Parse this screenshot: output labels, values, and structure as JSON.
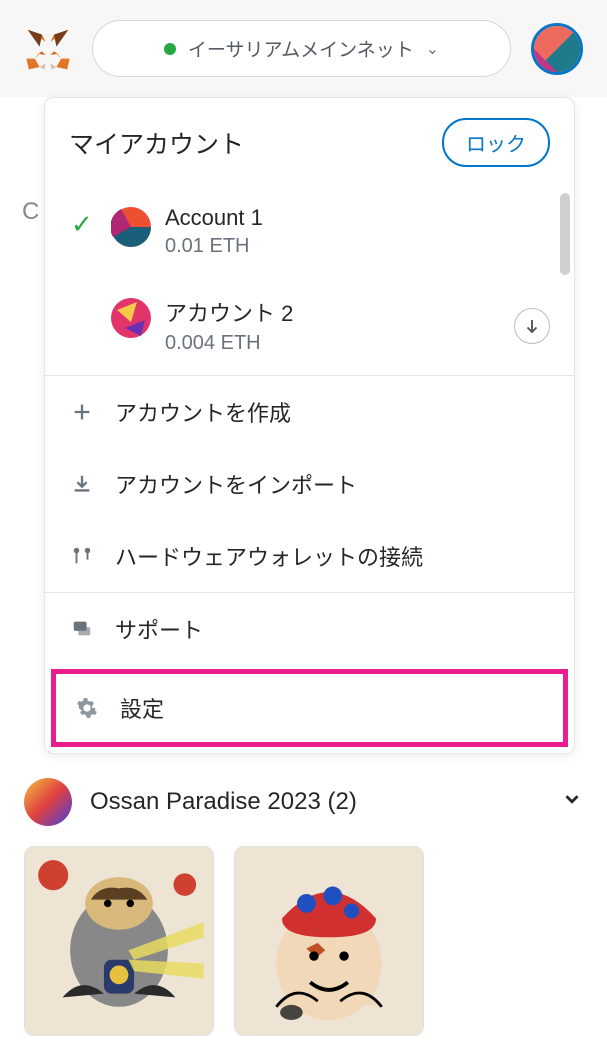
{
  "header": {
    "network_name": "イーサリアムメインネット"
  },
  "dropdown": {
    "title": "マイアカウント",
    "lock_label": "ロック"
  },
  "accounts": [
    {
      "name": "Account 1",
      "balance": "0.01 ETH",
      "selected": true
    },
    {
      "name": "アカウント 2",
      "balance": "0.004 ETH",
      "selected": false
    }
  ],
  "menu": {
    "create_account": "アカウントを作成",
    "import_account": "アカウントをインポート",
    "connect_hardware": "ハードウェアウォレットの接続",
    "support": "サポート",
    "settings": "設定"
  },
  "collection": {
    "name": "Ossan Paradise 2023 (2)"
  }
}
